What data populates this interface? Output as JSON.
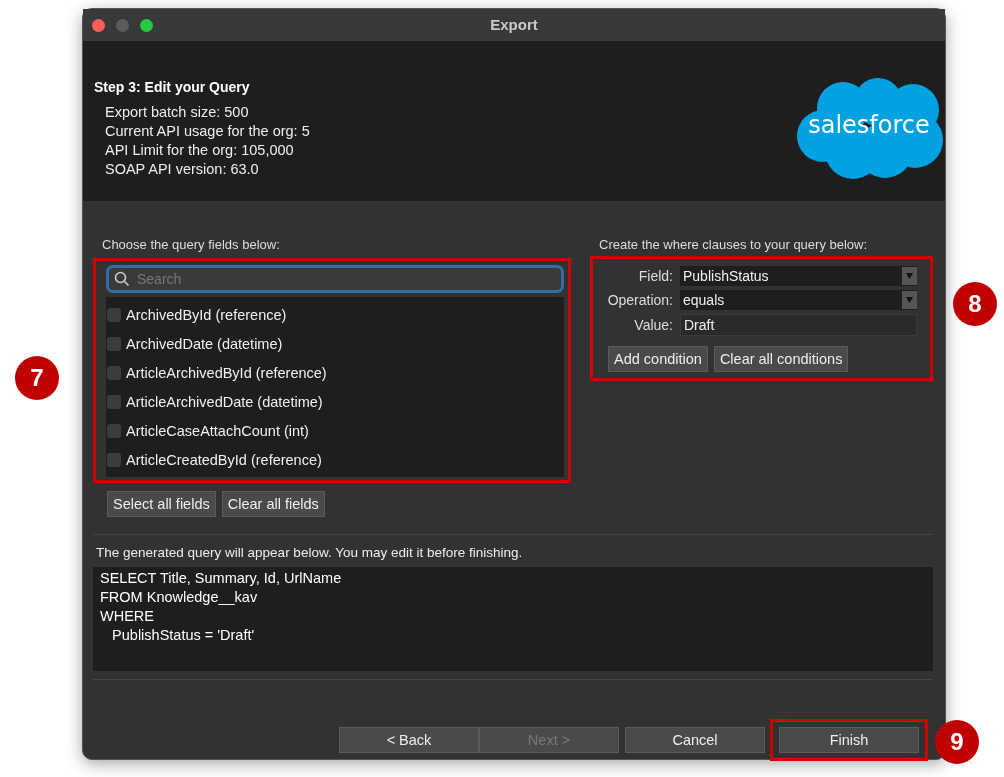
{
  "window": {
    "title": "Export"
  },
  "header": {
    "step_title": "Step 3: Edit your Query",
    "info_lines": [
      "Export batch size: 500",
      "Current API usage for the org: 5",
      "API Limit for the org: 105,000",
      "SOAP API version: 63.0"
    ],
    "logo_text": "salesforce"
  },
  "fields_panel": {
    "label": "Choose the query fields below:",
    "callout": "7",
    "search": {
      "placeholder": "Search",
      "focused": true
    },
    "items": [
      {
        "label": "ArchivedById (reference)",
        "checked": false
      },
      {
        "label": "ArchivedDate (datetime)",
        "checked": false
      },
      {
        "label": "ArticleArchivedById (reference)",
        "checked": false
      },
      {
        "label": "ArticleArchivedDate (datetime)",
        "checked": false
      },
      {
        "label": "ArticleCaseAttachCount (int)",
        "checked": false
      },
      {
        "label": "ArticleCreatedById (reference)",
        "checked": false
      }
    ],
    "buttons": [
      "Select all fields",
      "Clear all fields"
    ]
  },
  "where_panel": {
    "label": "Create the where clauses to your query below:",
    "callout": "8",
    "rows": [
      {
        "kind": "select",
        "label": "Field:",
        "value": "PublishStatus"
      },
      {
        "kind": "select",
        "label": "Operation:",
        "value": "equals"
      },
      {
        "kind": "input",
        "label": "Value:",
        "value": "Draft"
      }
    ],
    "buttons": [
      "Add condition",
      "Clear all conditions"
    ]
  },
  "query": {
    "label": "The generated query will appear below.  You may edit it before finishing.",
    "lines": [
      "SELECT Title, Summary, Id, UrlName",
      "FROM Knowledge__kav",
      "WHERE",
      "   PublishStatus = 'Draft'"
    ]
  },
  "footer": {
    "buttons": [
      {
        "label": "< Back",
        "disabled": false
      },
      {
        "label": "Next >",
        "disabled": true
      },
      {
        "label": "Cancel",
        "disabled": false
      },
      {
        "label": "Finish",
        "disabled": false,
        "callout": "9"
      }
    ]
  }
}
